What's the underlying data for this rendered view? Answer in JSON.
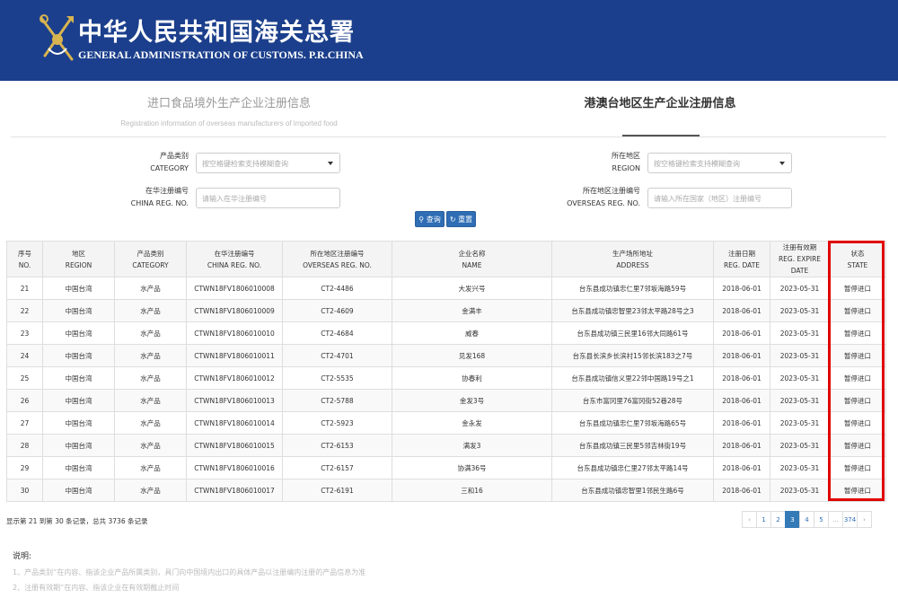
{
  "header": {
    "title_cn": "中华人民共和国海关总署",
    "title_en": "GENERAL ADMINISTRATION OF CUSTOMS. P.R.CHINA"
  },
  "tabs": {
    "left": {
      "cn": "进口食品境外生产企业注册信息",
      "en": "Registration information of overseas manufacturers of imported food"
    },
    "right": {
      "cn": "港澳台地区生产企业注册信息"
    }
  },
  "filters": {
    "category": {
      "label_cn": "产品类别",
      "label_en": "CATEGORY",
      "placeholder": "按空格键检索支持模糊查询"
    },
    "china_reg": {
      "label_cn": "在华注册编号",
      "label_en": "CHINA REG. NO.",
      "placeholder": "请输入在华注册编号"
    },
    "region": {
      "label_cn": "所在地区",
      "label_en": "REGION",
      "placeholder": "按空格键检索支持模糊查询"
    },
    "overseas_reg": {
      "label_cn": "所在地区注册编号",
      "label_en": "OVERSEAS REG. NO.",
      "placeholder": "请输入所在国家（地区）注册编号"
    },
    "search_label": "查询",
    "reset_label": "重置"
  },
  "table": {
    "columns": [
      {
        "cn": "序号",
        "en": "NO."
      },
      {
        "cn": "地区",
        "en": "REGION"
      },
      {
        "cn": "产品类别",
        "en": "CATEGORY"
      },
      {
        "cn": "在华注册编号",
        "en": "CHINA REG. NO."
      },
      {
        "cn": "所在地区注册编号",
        "en": "OVERSEAS REG. NO."
      },
      {
        "cn": "企业名称",
        "en": "NAME"
      },
      {
        "cn": "生产场所地址",
        "en": "ADDRESS"
      },
      {
        "cn": "注册日期",
        "en": "REG. DATE"
      },
      {
        "cn": "注册有效期",
        "en": "REG. EXPIRE DATE"
      },
      {
        "cn": "状态",
        "en": "STATE"
      }
    ],
    "rows": [
      [
        "21",
        "中国台湾",
        "水产品",
        "CTWN18FV1806010008",
        "CT2-4486",
        "大发兴号",
        "台东县成功镇忠仁里7邻坂海路59号",
        "2018-06-01",
        "2023-05-31",
        "暂停进口"
      ],
      [
        "22",
        "中国台湾",
        "水产品",
        "CTWN18FV1806010009",
        "CT2-4609",
        "金满丰",
        "台东县成功镇忠智里23邻太平路28号之3",
        "2018-06-01",
        "2023-05-31",
        "暂停进口"
      ],
      [
        "23",
        "中国台湾",
        "水产品",
        "CTWN18FV1806010010",
        "CT2-4684",
        "威春",
        "台东县成功镇三民里16邻大同路61号",
        "2018-06-01",
        "2023-05-31",
        "暂停进口"
      ],
      [
        "24",
        "中国台湾",
        "水产品",
        "CTWN18FV1806010011",
        "CT2-4701",
        "见发168",
        "台东县长滨乡长滨村15邻长滨183之7号",
        "2018-06-01",
        "2023-05-31",
        "暂停进口"
      ],
      [
        "25",
        "中国台湾",
        "水产品",
        "CTWN18FV1806010012",
        "CT2-5535",
        "协春利",
        "台东县成功镇信义里22邻中国路19号之1",
        "2018-06-01",
        "2023-05-31",
        "暂停进口"
      ],
      [
        "26",
        "中国台湾",
        "水产品",
        "CTWN18FV1806010013",
        "CT2-5788",
        "金发3号",
        "台东市富冈里76富冈街52巷28号",
        "2018-06-01",
        "2023-05-31",
        "暂停进口"
      ],
      [
        "27",
        "中国台湾",
        "水产品",
        "CTWN18FV1806010014",
        "CT2-5923",
        "金永发",
        "台东县成功镇忠仁里7邻坂海路65号",
        "2018-06-01",
        "2023-05-31",
        "暂停进口"
      ],
      [
        "28",
        "中国台湾",
        "水产品",
        "CTWN18FV1806010015",
        "CT2-6153",
        "满发3",
        "台东县成功镇三民里5邻吉林街19号",
        "2018-06-01",
        "2023-05-31",
        "暂停进口"
      ],
      [
        "29",
        "中国台湾",
        "水产品",
        "CTWN18FV1806010016",
        "CT2-6157",
        "协满36号",
        "台东县成功镇忠仁里27邻太平路14号",
        "2018-06-01",
        "2023-05-31",
        "暂停进口"
      ],
      [
        "30",
        "中国台湾",
        "水产品",
        "CTWN18FV1806010017",
        "CT2-6191",
        "三和16",
        "台东县成功镇忠智里1邻民生路6号",
        "2018-06-01",
        "2023-05-31",
        "暂停进口"
      ]
    ]
  },
  "pagination": {
    "summary": "显示第 21 到第 30 条记录，总共 3736 条记录",
    "prev": "‹",
    "pages": [
      "1",
      "2",
      "3",
      "4",
      "5",
      "...",
      "374"
    ],
    "next": "›",
    "current": "3"
  },
  "notes": {
    "title": "说明:",
    "items": [
      "1、产品类别“在内容、指该企业产品所属类别，具门向中国境内出口的具体产品以注册编内注册的产品信息为准",
      "2、注册有效期“在内容、指该企业在有效期截止时间"
    ]
  },
  "colors": {
    "header_bg": "#1b3f8c",
    "button": "#2f6db5",
    "highlight": "#e00000",
    "page_active": "#337ab7"
  },
  "icons": {
    "emblem": "customs-emblem-icon",
    "search": "search-icon",
    "reset": "refresh-icon",
    "dropdown": "caret-down-icon"
  }
}
